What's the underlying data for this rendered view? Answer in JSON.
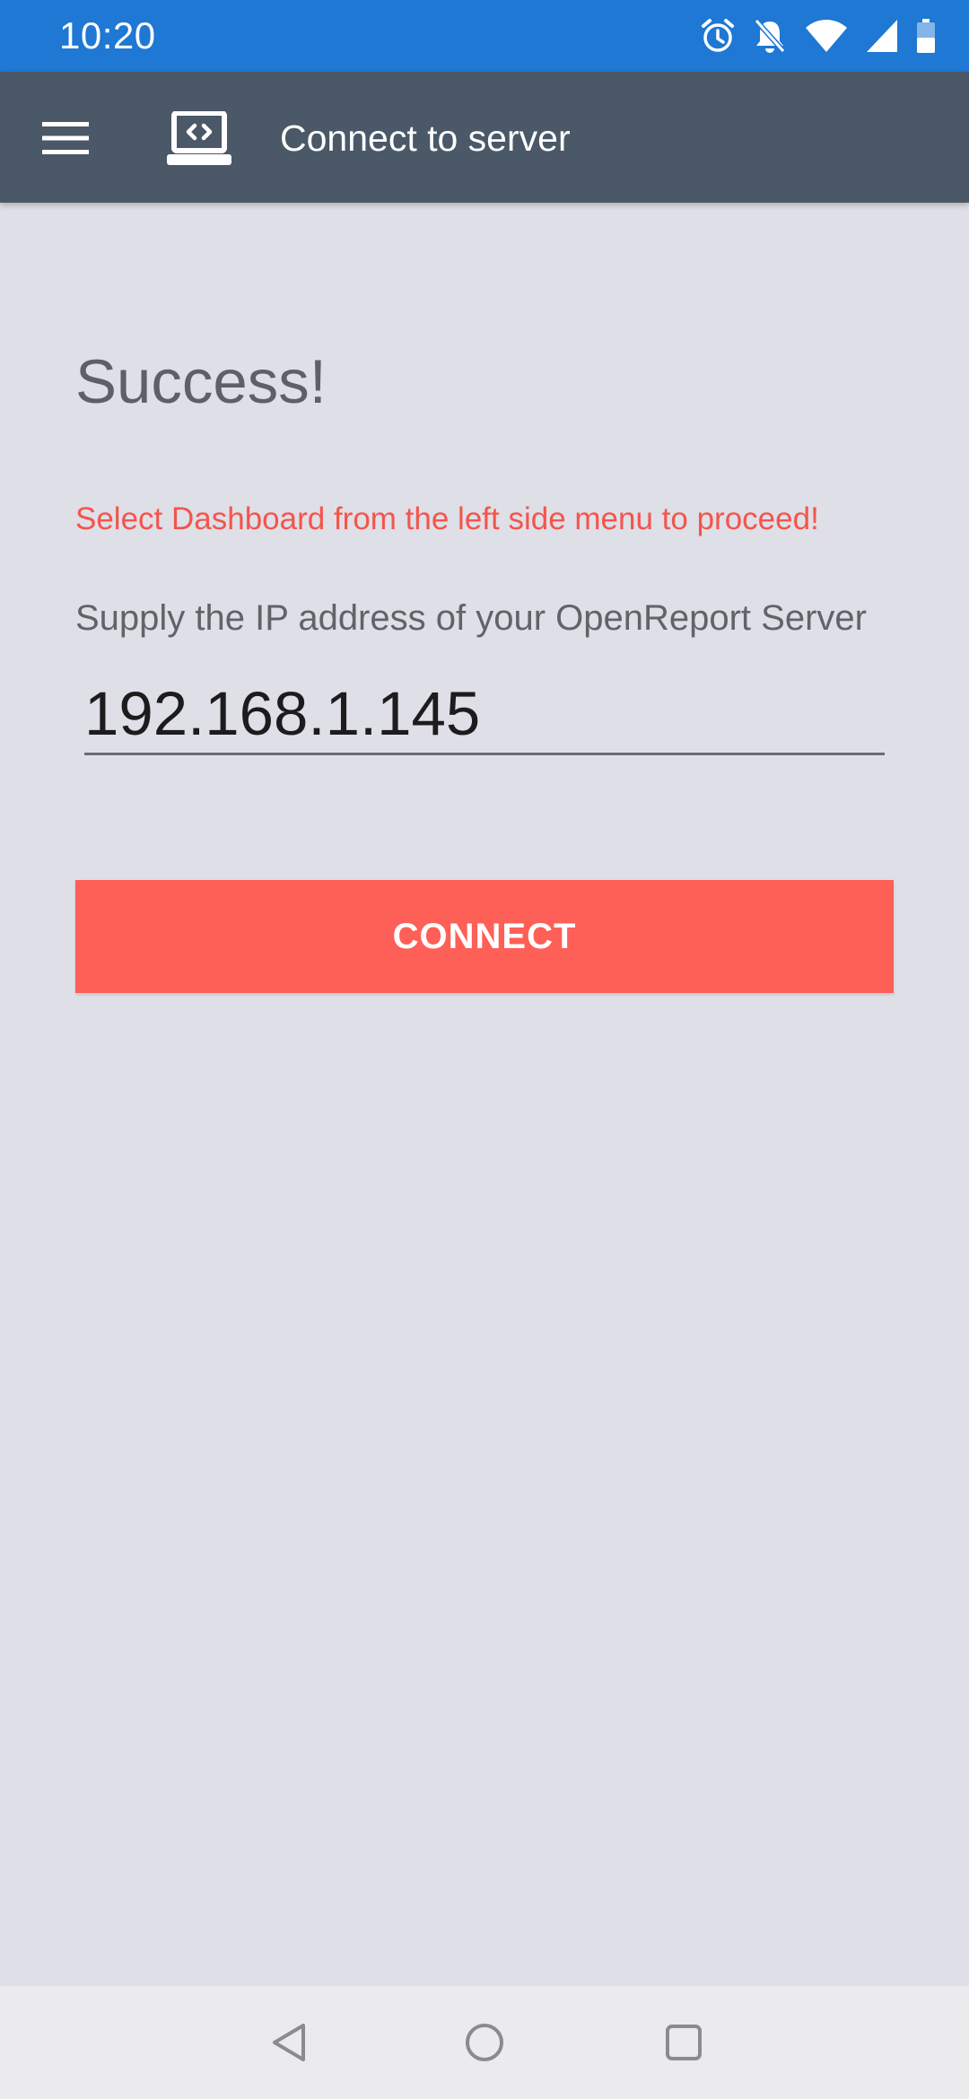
{
  "status_bar": {
    "time": "10:20",
    "icons": [
      "alarm-icon",
      "notifications-off-icon",
      "wifi-icon",
      "signal-icon",
      "battery-icon"
    ]
  },
  "app_bar": {
    "menu_icon": "menu-icon",
    "app_icon": "laptop-code-icon",
    "title": "Connect to server"
  },
  "main": {
    "heading": "Success!",
    "notice": "Select Dashboard from the left side menu to proceed!",
    "prompt": "Supply the IP address of your OpenReport Server",
    "ip_value": "192.168.1.145",
    "connect_label": "CONNECT"
  },
  "nav_bar": {
    "icons": [
      "back-icon",
      "home-icon",
      "recents-icon"
    ]
  },
  "colors": {
    "status_bar": "#1e78d4",
    "app_bar": "#4a5868",
    "background": "#dfdfe7",
    "accent": "#fe5f57",
    "notice_text": "#f3554c"
  }
}
